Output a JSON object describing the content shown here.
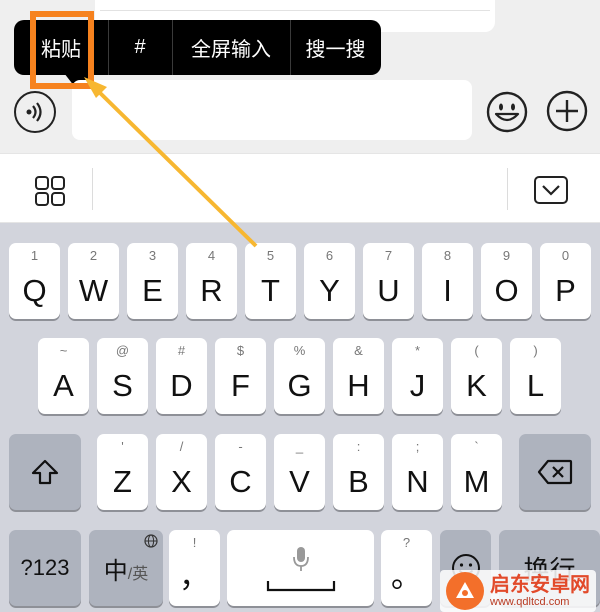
{
  "context_menu": {
    "items": [
      {
        "label": "粘贴"
      },
      {
        "label": "#"
      },
      {
        "label": "全屏输入"
      },
      {
        "label": "搜一搜"
      }
    ]
  },
  "colors": {
    "highlight": "#f6821e",
    "arrow": "#f7b731",
    "keyboard_bg": "#d2d4dc"
  },
  "input_bar": {
    "left_icon": "voice-icon",
    "right_icons": [
      "emoji-icon",
      "plus-icon"
    ]
  },
  "toolbar": {
    "left_icon": "grid-icon",
    "right_icon": "keyboard-collapse-icon"
  },
  "keyboard": {
    "row1": [
      {
        "main": "Q",
        "sub": "1"
      },
      {
        "main": "W",
        "sub": "2"
      },
      {
        "main": "E",
        "sub": "3"
      },
      {
        "main": "R",
        "sub": "4"
      },
      {
        "main": "T",
        "sub": "5"
      },
      {
        "main": "Y",
        "sub": "6"
      },
      {
        "main": "U",
        "sub": "7"
      },
      {
        "main": "I",
        "sub": "8"
      },
      {
        "main": "O",
        "sub": "9"
      },
      {
        "main": "P",
        "sub": "0"
      }
    ],
    "row2": [
      {
        "main": "A",
        "sub": "~"
      },
      {
        "main": "S",
        "sub": "@"
      },
      {
        "main": "D",
        "sub": "#"
      },
      {
        "main": "F",
        "sub": "$"
      },
      {
        "main": "G",
        "sub": "%"
      },
      {
        "main": "H",
        "sub": "&"
      },
      {
        "main": "J",
        "sub": "*"
      },
      {
        "main": "K",
        "sub": "("
      },
      {
        "main": "L",
        "sub": ")"
      }
    ],
    "row3": [
      {
        "main": "Z",
        "sub": "'"
      },
      {
        "main": "X",
        "sub": "/"
      },
      {
        "main": "C",
        "sub": "-"
      },
      {
        "main": "V",
        "sub": "_"
      },
      {
        "main": "B",
        "sub": ":"
      },
      {
        "main": "N",
        "sub": ";"
      },
      {
        "main": "M",
        "sub": "`"
      }
    ],
    "num_key": "?123",
    "lang_main": "中",
    "lang_sub": "/英",
    "comma_main": "，",
    "comma_sub": "!",
    "period_main": "。",
    "period_sub": "?",
    "return_label": "换行"
  },
  "watermark": {
    "title": "启东安卓网",
    "url": "www.qdltcd.com"
  }
}
